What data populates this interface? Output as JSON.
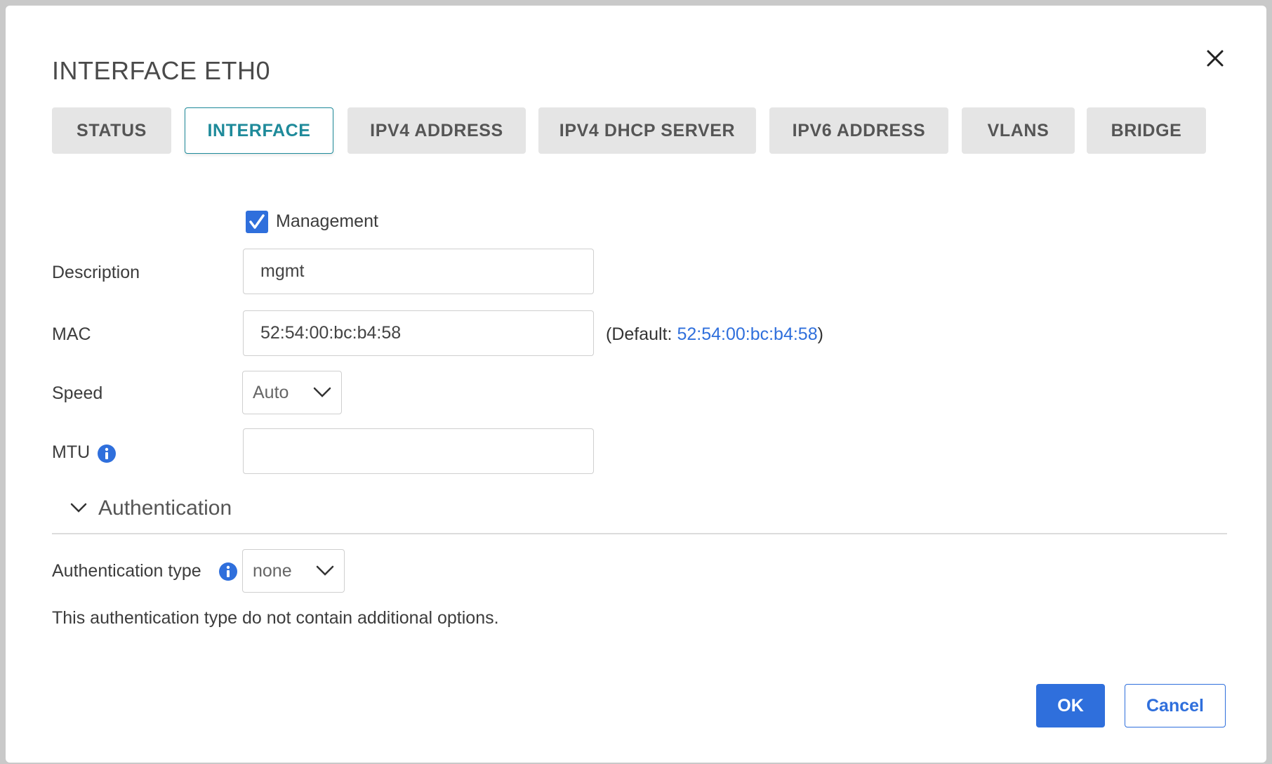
{
  "dialog": {
    "title": "INTERFACE ETH0",
    "close_icon": "close-icon"
  },
  "tabs": [
    {
      "label": "STATUS",
      "active": false
    },
    {
      "label": "INTERFACE",
      "active": true
    },
    {
      "label": "IPV4 ADDRESS",
      "active": false
    },
    {
      "label": "IPV4 DHCP SERVER",
      "active": false
    },
    {
      "label": "IPV6 ADDRESS",
      "active": false
    },
    {
      "label": "VLANS",
      "active": false
    },
    {
      "label": "BRIDGE",
      "active": false
    }
  ],
  "form": {
    "management": {
      "label": "Management",
      "checked": true
    },
    "description": {
      "label": "Description",
      "value": "mgmt"
    },
    "mac": {
      "label": "MAC",
      "value": "52:54:00:bc:b4:58",
      "default_prefix": "(Default: ",
      "default_value": "52:54:00:bc:b4:58",
      "default_suffix": ")"
    },
    "speed": {
      "label": "Speed",
      "value": "Auto"
    },
    "mtu": {
      "label": "MTU",
      "value": ""
    }
  },
  "authentication": {
    "section_title": "Authentication",
    "type_label": "Authentication type",
    "type_value": "none",
    "note": "This authentication type do not contain additional options."
  },
  "buttons": {
    "ok": "OK",
    "cancel": "Cancel"
  },
  "colors": {
    "primary": "#2f6fdc",
    "tab_active": "#1e8a9a",
    "tab_bg": "#e5e5e5"
  }
}
